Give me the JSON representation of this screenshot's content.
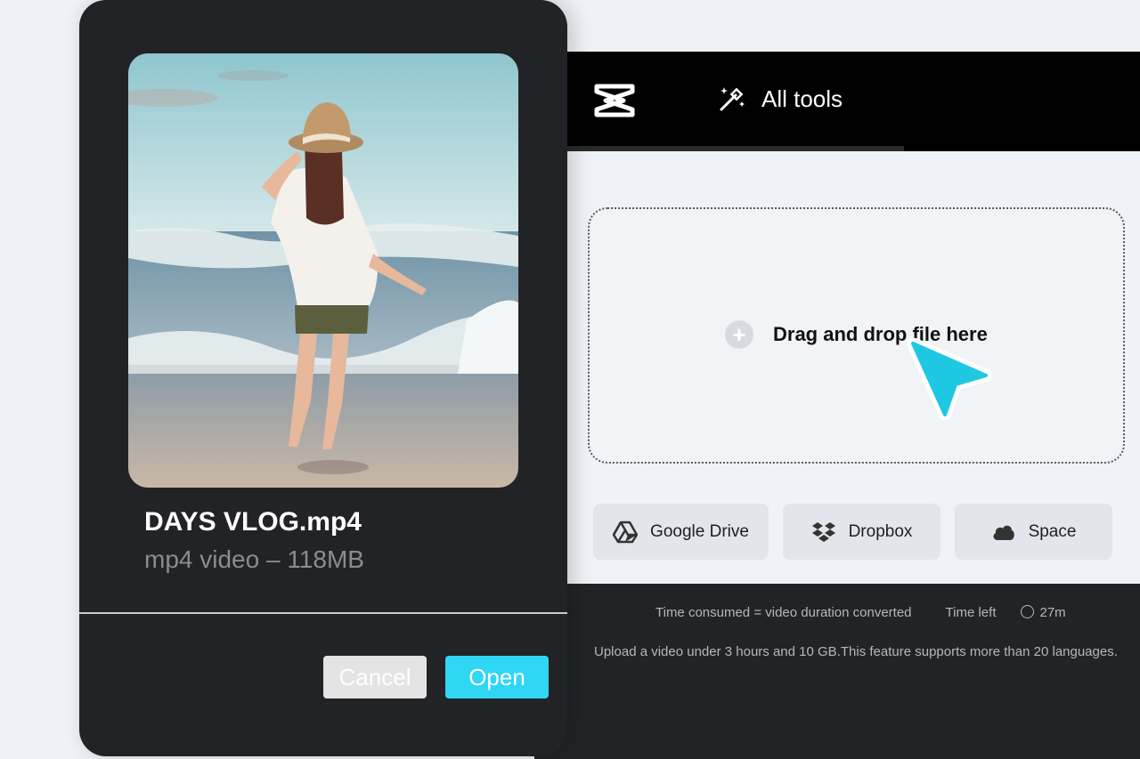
{
  "header": {
    "logo_icon": "capcut-logo-icon",
    "all_tools_icon": "magic-wand-icon",
    "all_tools_label": "All tools"
  },
  "dropzone": {
    "add_icon": "plus-icon",
    "label": "Drag and drop file here"
  },
  "sources": [
    {
      "icon": "google-drive-icon",
      "label": "Google Drive"
    },
    {
      "icon": "dropbox-icon",
      "label": "Dropbox"
    },
    {
      "icon": "cloud-icon",
      "label": "Space"
    }
  ],
  "footer": {
    "time_consumed": "Time consumed = video duration converted",
    "time_left_label": "Time left",
    "time_left_value": "27m",
    "info": "Upload a video under 3 hours and 10 GB.This feature supports more than 20 languages."
  },
  "file_card": {
    "thumbnail": "beach-photo-woman-in-hat",
    "file_name": "DAYS VLOG.mp4",
    "file_meta": "mp4 video – 118MB",
    "cancel_label": "Cancel",
    "open_label": "Open"
  },
  "colors": {
    "accent": "#2fd7f4",
    "dark_panel": "#222326",
    "topbar": "#000000"
  }
}
